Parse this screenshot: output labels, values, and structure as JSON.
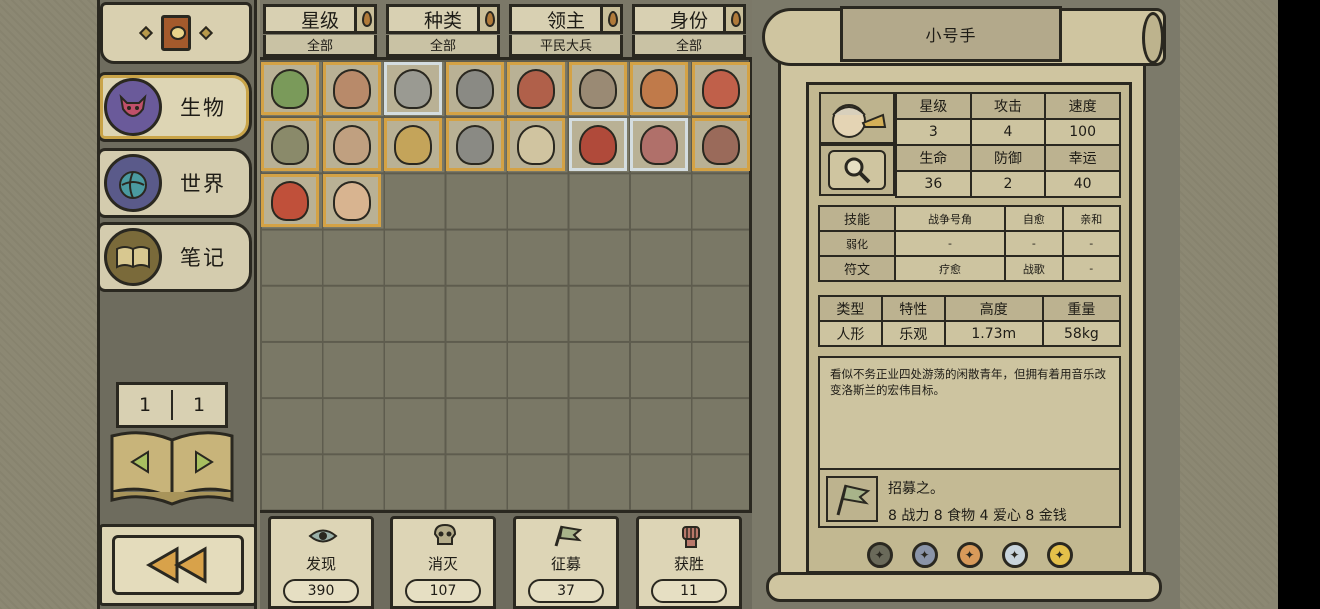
{
  "filters": [
    {
      "title": "星级",
      "value": "全部"
    },
    {
      "title": "种类",
      "value": "全部"
    },
    {
      "title": "领主",
      "value": "平民大兵"
    },
    {
      "title": "身份",
      "value": "全部"
    }
  ],
  "nav": {
    "tabs": [
      {
        "label": "生物",
        "icon": "creature-demon-icon",
        "active": true
      },
      {
        "label": "世界",
        "icon": "world-globe-icon",
        "active": false
      },
      {
        "label": "笔记",
        "icon": "notes-book-icon",
        "active": false
      }
    ],
    "page_current": "1",
    "page_total": "1"
  },
  "grid": {
    "columns": 8,
    "rows": 8,
    "creatures": [
      {
        "name": "creature-1",
        "frame": "gold",
        "color": "#7a9a5a"
      },
      {
        "name": "creature-2",
        "frame": "gold",
        "color": "#b88a6a"
      },
      {
        "name": "creature-3",
        "frame": "silver",
        "color": "#9a9a92"
      },
      {
        "name": "creature-4",
        "frame": "gold",
        "color": "#8a8a84"
      },
      {
        "name": "creature-5",
        "frame": "gold",
        "color": "#b0604a"
      },
      {
        "name": "creature-6",
        "frame": "gold",
        "color": "#9a8a74"
      },
      {
        "name": "creature-7",
        "frame": "gold",
        "color": "#c07a4a"
      },
      {
        "name": "creature-8",
        "frame": "gold",
        "color": "#c0604a"
      },
      {
        "name": "creature-9",
        "frame": "gold",
        "color": "#8a8a6a"
      },
      {
        "name": "creature-10",
        "frame": "gold",
        "color": "#c0a080"
      },
      {
        "name": "creature-11",
        "frame": "gold",
        "color": "#c4a45a"
      },
      {
        "name": "creature-12",
        "frame": "gold",
        "color": "#8a8a84"
      },
      {
        "name": "creature-13",
        "frame": "gold",
        "color": "#d0c4a0"
      },
      {
        "name": "creature-14",
        "frame": "silver",
        "color": "#b04a3a"
      },
      {
        "name": "creature-15",
        "frame": "silver",
        "color": "#b0706a"
      },
      {
        "name": "creature-16",
        "frame": "gold",
        "color": "#9a6a5a"
      },
      {
        "name": "creature-17",
        "frame": "gold",
        "color": "#c0503a"
      },
      {
        "name": "creature-18",
        "frame": "gold",
        "color": "#d8b490"
      }
    ]
  },
  "stats": [
    {
      "label": "发现",
      "value": "390",
      "icon": "eye-icon"
    },
    {
      "label": "消灭",
      "value": "107",
      "icon": "skull-icon"
    },
    {
      "label": "征募",
      "value": "37",
      "icon": "flag-icon"
    },
    {
      "label": "获胜",
      "value": "11",
      "icon": "fist-icon"
    }
  ],
  "detail": {
    "name": "小号手",
    "attributes": {
      "headers_1": [
        "星级",
        "攻击",
        "速度"
      ],
      "values_1": [
        "3",
        "4",
        "100"
      ],
      "headers_2": [
        "生命",
        "防御",
        "幸运"
      ],
      "values_2": [
        "36",
        "2",
        "40"
      ]
    },
    "skills": {
      "skill_label": "技能",
      "skills": [
        "战争号角",
        "自愈",
        "亲和"
      ],
      "weak_label": "弱化",
      "weaks": [
        "-",
        "-",
        "-"
      ],
      "rune_label": "符文",
      "runes": [
        "疗愈",
        "战歌",
        "-"
      ]
    },
    "traits": {
      "headers": [
        "类型",
        "特性",
        "高度",
        "重量"
      ],
      "values": [
        "人形",
        "乐观",
        "1.73m",
        "58kg"
      ]
    },
    "description": "看似不务正业四处游荡的闲散青年，但拥有着用音乐改变洛斯兰的宏伟目标。",
    "recruit_title": "招募之。",
    "recruit_cost": "8 战力 8 食物 4 爱心 8 金钱",
    "badges": [
      {
        "icon": "bronze-badge-icon",
        "color": "#6a6a5a"
      },
      {
        "icon": "silver-badge-icon",
        "color": "#8a94a8"
      },
      {
        "icon": "copper-badge-icon",
        "color": "#d89a5a"
      },
      {
        "icon": "platinum-badge-icon",
        "color": "#c8d4dc"
      },
      {
        "icon": "gold-badge-icon",
        "color": "#e4c04a"
      }
    ]
  }
}
